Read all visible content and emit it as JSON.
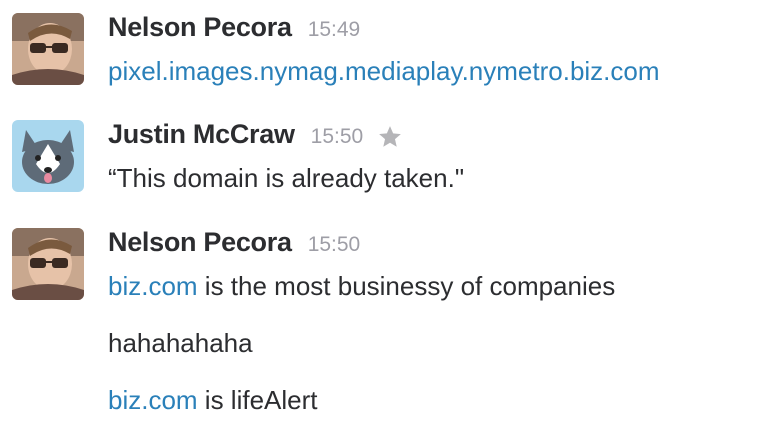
{
  "messages": [
    {
      "author": "Nelson Pecora",
      "time": "15:49",
      "avatar": "photo-avatar-nelson",
      "lines": [
        {
          "link": "pixel.images.nymag.mediaplay.nymetro.biz.com",
          "text": ""
        }
      ]
    },
    {
      "author": "Justin McCraw",
      "time": "15:50",
      "avatar": "husky-avatar",
      "starred_icon": "star-icon",
      "lines": [
        {
          "link": "",
          "text": "“This domain is already taken.\""
        }
      ]
    },
    {
      "author": "Nelson Pecora",
      "time": "15:50",
      "avatar": "photo-avatar-nelson",
      "lines": [
        {
          "link": "biz.com",
          "text": " is the most businessy of companies"
        },
        {
          "link": "",
          "text": "hahahahaha"
        },
        {
          "link": "biz.com",
          "text": " is lifeAlert"
        }
      ]
    }
  ],
  "colors": {
    "link": "#2a80b9",
    "author": "#2c2d30",
    "timestamp": "#9e9ea6",
    "star": "#b5b5b8",
    "husky_bg": "#a9d7ee"
  }
}
